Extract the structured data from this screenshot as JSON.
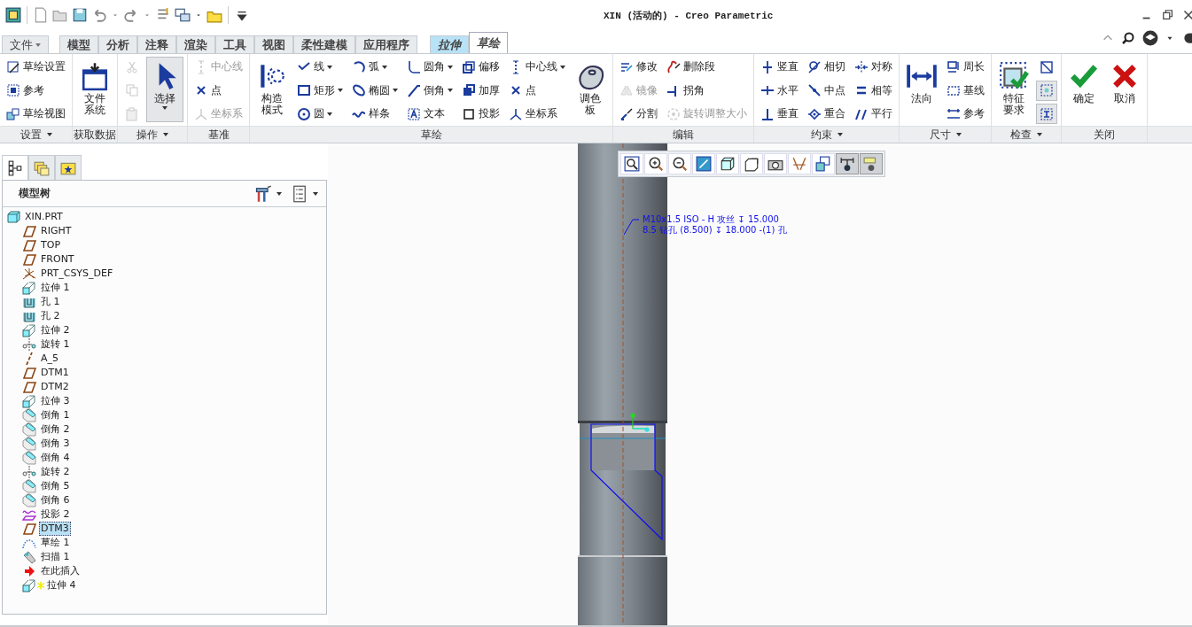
{
  "window": {
    "title": "XIN (活动的) - Creo Parametric"
  },
  "menu_tabs": [
    {
      "label": "文件",
      "kind": "file",
      "selected": false
    },
    {
      "label": "模型",
      "kind": "tab",
      "selected": false
    },
    {
      "label": "分析",
      "kind": "tab",
      "selected": false
    },
    {
      "label": "注释",
      "kind": "tab",
      "selected": false
    },
    {
      "label": "渲染",
      "kind": "tab",
      "selected": false
    },
    {
      "label": "工具",
      "kind": "tab",
      "selected": false
    },
    {
      "label": "视图",
      "kind": "tab",
      "selected": false
    },
    {
      "label": "柔性建模",
      "kind": "tab",
      "selected": false
    },
    {
      "label": "应用程序",
      "kind": "tab",
      "selected": false
    },
    {
      "label": "拉伸",
      "kind": "context",
      "selected": false
    },
    {
      "label": "草绘",
      "kind": "context",
      "selected": true
    }
  ],
  "ribbon_groups": [
    {
      "label": "设置",
      "menu": true,
      "columns": [
        [
          {
            "kind": "small",
            "label": "草绘设置",
            "disabled": false,
            "dropdown": false
          },
          {
            "kind": "small",
            "label": "参考",
            "disabled": false,
            "dropdown": false
          },
          {
            "kind": "small",
            "label": "草绘视图",
            "disabled": false,
            "dropdown": false
          }
        ]
      ]
    },
    {
      "label": "获取数据",
      "menu": false,
      "columns": [
        [
          {
            "kind": "large",
            "label": "文件系统",
            "disabled": false,
            "dropdown": false,
            "selected": false
          }
        ]
      ]
    },
    {
      "label": "操作",
      "menu": true,
      "columns": [
        [
          {
            "kind": "icon",
            "disabled": true,
            "dropdown": false,
            "selected": false
          },
          {
            "kind": "icon",
            "disabled": true,
            "dropdown": false,
            "selected": false
          },
          {
            "kind": "icon",
            "disabled": true,
            "dropdown": false,
            "selected": false
          }
        ],
        [
          {
            "kind": "large",
            "label": "选择",
            "disabled": false,
            "dropdown": true,
            "selected": true
          }
        ]
      ]
    },
    {
      "label": "基准",
      "menu": false,
      "columns": [
        [
          {
            "kind": "small",
            "label": "中心线",
            "disabled": true,
            "dropdown": false,
            "selected": false
          },
          {
            "kind": "small",
            "label": "点",
            "disabled": false,
            "dropdown": false,
            "selected": false
          },
          {
            "kind": "small",
            "label": "坐标系",
            "disabled": true,
            "dropdown": false,
            "selected": false
          }
        ]
      ]
    },
    {
      "label": "草绘",
      "menu": false,
      "columns": [
        [
          {
            "kind": "large",
            "label": "构造模式",
            "disabled": false,
            "dropdown": false,
            "selected": false
          }
        ],
        [
          {
            "kind": "small",
            "label": "线",
            "disabled": false,
            "dropdown": true,
            "selected": false
          },
          {
            "kind": "small",
            "label": "矩形",
            "disabled": false,
            "dropdown": true,
            "selected": false
          },
          {
            "kind": "small",
            "label": "圆",
            "disabled": false,
            "dropdown": true,
            "selected": false
          }
        ],
        [
          {
            "kind": "small",
            "label": "弧",
            "disabled": false,
            "dropdown": true,
            "selected": false
          },
          {
            "kind": "small",
            "label": "椭圆",
            "disabled": false,
            "dropdown": true,
            "selected": false
          },
          {
            "kind": "small",
            "label": "样条",
            "disabled": false,
            "dropdown": false,
            "selected": false
          }
        ],
        [
          {
            "kind": "small",
            "label": "圆角",
            "disabled": false,
            "dropdown": true,
            "selected": false
          },
          {
            "kind": "small",
            "label": "倒角",
            "disabled": false,
            "dropdown": true,
            "selected": false
          },
          {
            "kind": "small",
            "label": "文本",
            "disabled": false,
            "dropdown": false,
            "selected": false
          }
        ],
        [
          {
            "kind": "small",
            "label": "偏移",
            "disabled": false,
            "dropdown": false,
            "selected": false
          },
          {
            "kind": "small",
            "label": "加厚",
            "disabled": false,
            "dropdown": false,
            "selected": false
          },
          {
            "kind": "small",
            "label": "投影",
            "disabled": false,
            "dropdown": false,
            "selected": false
          }
        ],
        [
          {
            "kind": "small",
            "label": "中心线",
            "disabled": false,
            "dropdown": true,
            "selected": false
          },
          {
            "kind": "small",
            "label": "点",
            "disabled": false,
            "dropdown": false,
            "selected": false
          },
          {
            "kind": "small",
            "label": "坐标系",
            "disabled": false,
            "dropdown": false,
            "selected": false
          }
        ],
        [
          {
            "kind": "large",
            "label": "调色板",
            "disabled": false,
            "dropdown": false,
            "selected": false
          }
        ]
      ]
    },
    {
      "label": "编辑",
      "menu": false,
      "columns": [
        [
          {
            "kind": "small",
            "label": "修改",
            "disabled": false,
            "dropdown": false,
            "selected": false
          },
          {
            "kind": "small",
            "label": "镜像",
            "disabled": true,
            "dropdown": false,
            "selected": false
          },
          {
            "kind": "small",
            "label": "分割",
            "disabled": false,
            "dropdown": false,
            "selected": false
          }
        ],
        [
          {
            "kind": "small",
            "label": "删除段",
            "disabled": false,
            "dropdown": false,
            "selected": false
          },
          {
            "kind": "small",
            "label": "拐角",
            "disabled": false,
            "dropdown": false,
            "selected": false
          },
          {
            "kind": "small",
            "label": "旋转调整大小",
            "disabled": true,
            "dropdown": false,
            "selected": false
          }
        ]
      ]
    },
    {
      "label": "约束",
      "menu": true,
      "columns": [
        [
          {
            "kind": "small",
            "label": "竖直",
            "disabled": false,
            "dropdown": false,
            "selected": false
          },
          {
            "kind": "small",
            "label": "水平",
            "disabled": false,
            "dropdown": false,
            "selected": false
          },
          {
            "kind": "small",
            "label": "垂直",
            "disabled": false,
            "dropdown": false,
            "selected": false
          }
        ],
        [
          {
            "kind": "small",
            "label": "相切",
            "disabled": false,
            "dropdown": false,
            "selected": false
          },
          {
            "kind": "small",
            "label": "中点",
            "disabled": false,
            "dropdown": false,
            "selected": false
          },
          {
            "kind": "small",
            "label": "重合",
            "disabled": false,
            "dropdown": false,
            "selected": false
          }
        ],
        [
          {
            "kind": "small",
            "label": "对称",
            "disabled": false,
            "dropdown": false,
            "selected": false
          },
          {
            "kind": "small",
            "label": "相等",
            "disabled": false,
            "dropdown": false,
            "selected": false
          },
          {
            "kind": "small",
            "label": "平行",
            "disabled": false,
            "dropdown": false,
            "selected": false
          }
        ]
      ]
    },
    {
      "label": "尺寸",
      "menu": true,
      "columns": [
        [
          {
            "kind": "large",
            "label": "法向",
            "disabled": false,
            "dropdown": false,
            "selected": false
          }
        ],
        [
          {
            "kind": "small",
            "label": "周长",
            "disabled": false,
            "dropdown": false,
            "selected": false
          },
          {
            "kind": "small",
            "label": "基线",
            "disabled": false,
            "dropdown": false,
            "selected": false
          },
          {
            "kind": "small",
            "label": "参考",
            "disabled": false,
            "dropdown": false,
            "selected": false
          }
        ]
      ]
    },
    {
      "label": "检查",
      "menu": true,
      "columns": [
        [
          {
            "kind": "large",
            "label": "特征要求",
            "disabled": false,
            "dropdown": false,
            "selected": false
          }
        ],
        [
          {
            "kind": "icon",
            "disabled": false,
            "dropdown": false,
            "selected": false
          },
          {
            "kind": "icon",
            "disabled": false,
            "dropdown": false,
            "selected": true
          },
          {
            "kind": "icon",
            "disabled": false,
            "dropdown": false,
            "selected": true
          }
        ]
      ]
    },
    {
      "label": "关闭",
      "menu": false,
      "columns": [
        [
          {
            "kind": "large",
            "label": "确定",
            "disabled": false,
            "dropdown": false,
            "selected": false
          }
        ],
        [
          {
            "kind": "large",
            "label": "取消",
            "disabled": false,
            "dropdown": false,
            "selected": false
          }
        ]
      ]
    }
  ],
  "model_tree": {
    "title": "模型树",
    "tabs": [
      {
        "selected": true
      },
      {
        "selected": false
      },
      {
        "selected": false
      }
    ],
    "root": {
      "label": "XIN.PRT",
      "kind": "part",
      "selected": false,
      "marked": false,
      "children": [
        {
          "label": "RIGHT",
          "kind": "plane",
          "selected": false,
          "marked": false
        },
        {
          "label": "TOP",
          "kind": "plane",
          "selected": false,
          "marked": false
        },
        {
          "label": "FRONT",
          "kind": "plane",
          "selected": false,
          "marked": false
        },
        {
          "label": "PRT_CSYS_DEF",
          "kind": "csys",
          "selected": false,
          "marked": false
        },
        {
          "label": "拉伸 1",
          "kind": "extrude",
          "selected": false,
          "marked": false
        },
        {
          "label": "孔 1",
          "kind": "hole",
          "selected": false,
          "marked": false
        },
        {
          "label": "孔 2",
          "kind": "hole",
          "selected": false,
          "marked": false
        },
        {
          "label": "拉伸 2",
          "kind": "extrude",
          "selected": false,
          "marked": false
        },
        {
          "label": "旋转 1",
          "kind": "revolve",
          "selected": false,
          "marked": false
        },
        {
          "label": "A_5",
          "kind": "axis",
          "selected": false,
          "marked": false
        },
        {
          "label": "DTM1",
          "kind": "plane",
          "selected": false,
          "marked": false
        },
        {
          "label": "DTM2",
          "kind": "plane",
          "selected": false,
          "marked": false
        },
        {
          "label": "拉伸 3",
          "kind": "extrude",
          "selected": false,
          "marked": false
        },
        {
          "label": "倒角 1",
          "kind": "chamfer",
          "selected": false,
          "marked": false
        },
        {
          "label": "倒角 2",
          "kind": "chamfer",
          "selected": false,
          "marked": false
        },
        {
          "label": "倒角 3",
          "kind": "chamfer",
          "selected": false,
          "marked": false
        },
        {
          "label": "倒角 4",
          "kind": "chamfer",
          "selected": false,
          "marked": false
        },
        {
          "label": "旋转 2",
          "kind": "revolve",
          "selected": false,
          "marked": false
        },
        {
          "label": "倒角 5",
          "kind": "chamfer",
          "selected": false,
          "marked": false
        },
        {
          "label": "倒角 6",
          "kind": "chamfer",
          "selected": false,
          "marked": false
        },
        {
          "label": "投影 2",
          "kind": "project",
          "selected": false,
          "marked": false
        },
        {
          "label": "DTM3",
          "kind": "plane",
          "selected": true,
          "marked": false
        },
        {
          "label": "草绘 1",
          "kind": "sketch",
          "selected": false,
          "marked": false
        },
        {
          "label": "扫描 1",
          "kind": "sweep",
          "selected": false,
          "marked": false
        },
        {
          "label": "在此插入",
          "kind": "insert",
          "selected": false,
          "marked": false
        },
        {
          "label": "拉伸 4",
          "kind": "extrude",
          "selected": false,
          "marked": true
        }
      ]
    }
  },
  "viewport": {
    "toolbar": [
      {
        "selected": false
      },
      {
        "selected": false
      },
      {
        "selected": false
      },
      {
        "selected": false
      },
      {
        "selected": false
      },
      {
        "selected": false
      },
      {
        "selected": false
      },
      {
        "selected": false
      },
      {
        "selected": false
      },
      {
        "selected": true
      },
      {
        "selected": true
      }
    ],
    "annotation": [
      "M10x1.5 ISO - H 攻丝 ↧ 15.000",
      "8.5 钻孔 (8.500) ↧ 18.000 -(1) 孔"
    ]
  }
}
